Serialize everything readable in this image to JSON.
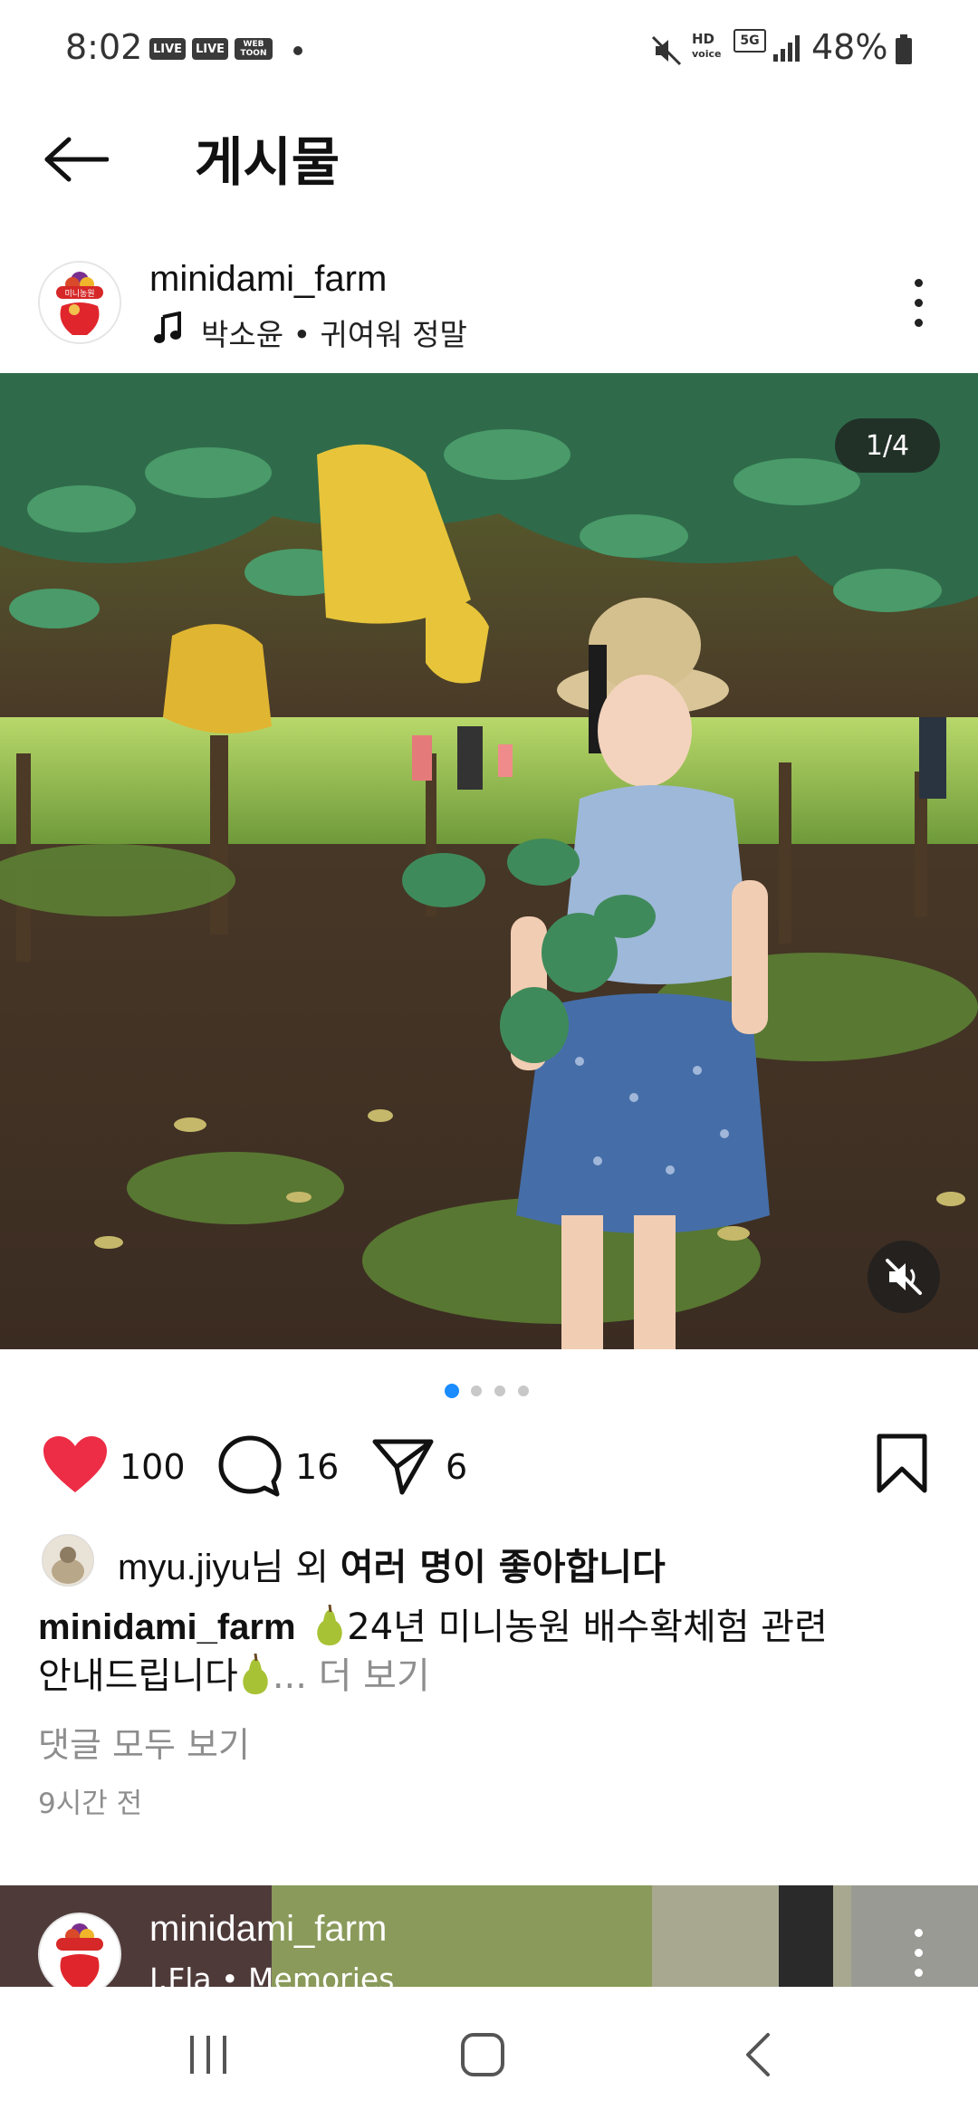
{
  "status_bar": {
    "time": "8:02",
    "badges": [
      "LIVE",
      "LIVE",
      "WEB TOON"
    ],
    "network": "HD 5G",
    "battery": "48%"
  },
  "header": {
    "title": "게시물",
    "back_icon": "back-arrow-icon"
  },
  "post": {
    "author": "minidami_farm",
    "music": "박소윤 • 귀여워 정말",
    "image_counter": "1/4",
    "carousel_total": 4,
    "carousel_active": 1,
    "likes_count": "100",
    "comments_count": "16",
    "shares_count": "6",
    "liked_by_user": "myu.jiyu",
    "liked_by_suffix": "님 외 ",
    "liked_by_bold": "여러 명이 좋아합니다",
    "caption_user": "minidami_farm",
    "caption_text_1": "24년 미니농원 배수확체험 관련",
    "caption_text_2": "안내드립니다",
    "caption_more": "... 더 보기",
    "view_comments": "댓글 모두 보기",
    "time_ago": "9시간 전",
    "colors": {
      "like": "#ed2c45",
      "active_dot": "#1a8cff",
      "muted_text": "#8e8e8e"
    }
  },
  "next_post": {
    "author": "minidami_farm",
    "music": "J.Fla • Memories"
  }
}
